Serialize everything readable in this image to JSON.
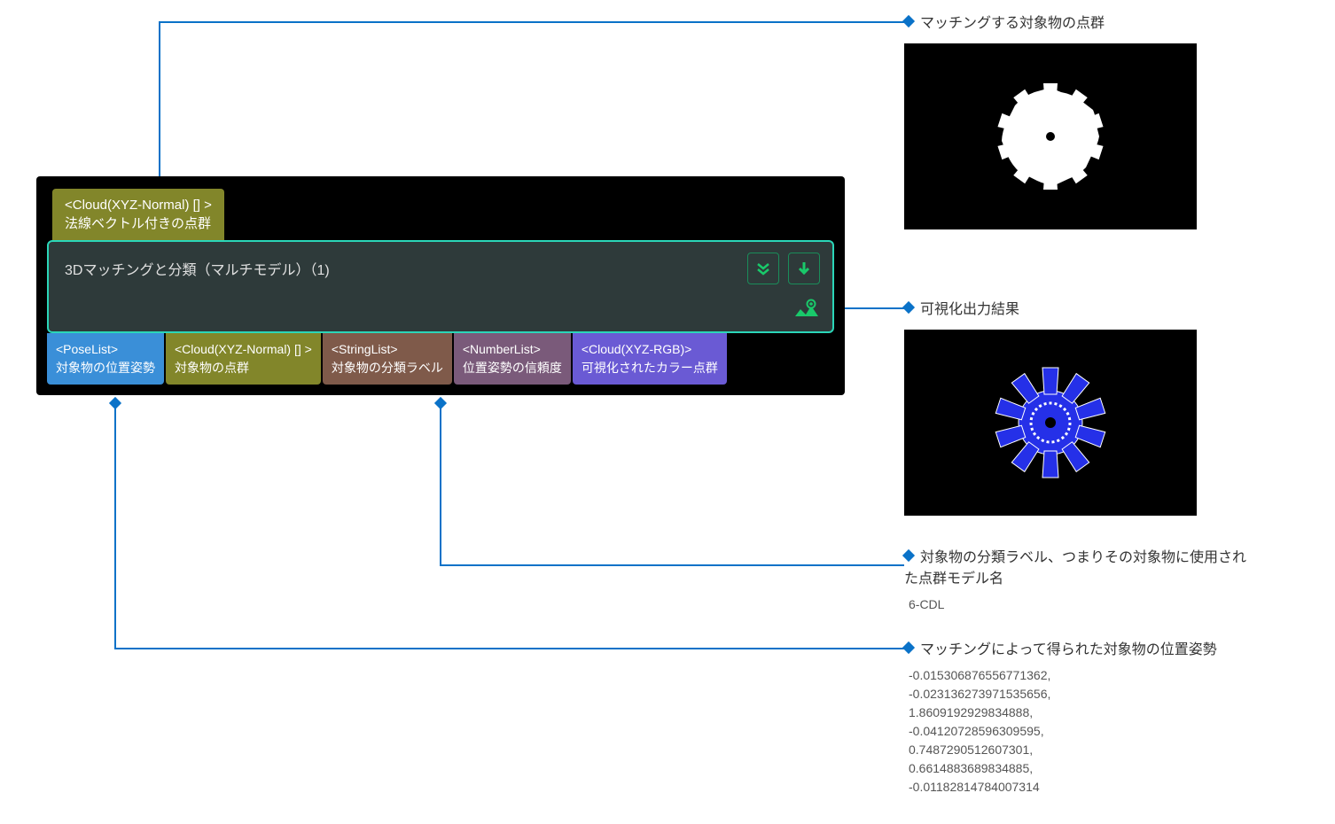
{
  "node": {
    "input_port_type": "<Cloud(XYZ-Normal) [] >",
    "input_port_label": "法線ベクトル付きの点群",
    "title": "3Dマッチングと分類（マルチモデル）（1)",
    "outputs": [
      {
        "type": "<PoseList>",
        "label": "対象物の位置姿勢",
        "cls": "port-blue"
      },
      {
        "type": "<Cloud(XYZ-Normal) [] >",
        "label": "対象物の点群",
        "cls": "port-olive"
      },
      {
        "type": "<StringList>",
        "label": "対象物の分類ラベル",
        "cls": "port-brown"
      },
      {
        "type": "<NumberList>",
        "label": "位置姿勢の信頼度",
        "cls": "port-mauve"
      },
      {
        "type": "<Cloud(XYZ-RGB)>",
        "label": "可視化されたカラー点群",
        "cls": "port-purple"
      }
    ]
  },
  "annotations": {
    "top": "マッチングする対象物の点群",
    "eye": "可視化出力結果",
    "label": {
      "title": "対象物の分類ラベル、つまりその対象物に使用された点群モデル名",
      "value": "6-CDL"
    },
    "pose": {
      "title": "マッチングによって得られた対象物の位置姿勢",
      "values": [
        "-0.015306876556771362,",
        "-0.023136273971535656,",
        "1.8609192929834888,",
        "-0.04120728596309595,",
        "0.7487290512607301,",
        "0.6614883689834885,",
        "-0.01182814784007314"
      ]
    }
  }
}
